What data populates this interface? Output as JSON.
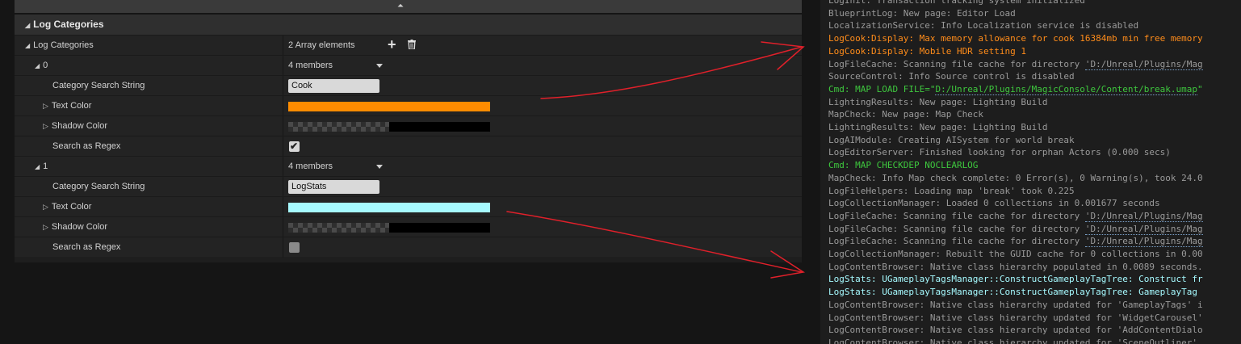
{
  "panel": {
    "header_title": "Log Categories",
    "array_label": "Log Categories",
    "array_value": "2 Array elements",
    "elements": [
      {
        "index": "0",
        "members": "4 members",
        "search_label": "Category Search String",
        "search_value": "Cook",
        "text_color_label": "Text Color",
        "text_color": "#ff8c00",
        "shadow_color_label": "Shadow Color",
        "regex_label": "Search as Regex",
        "regex_checked": true
      },
      {
        "index": "1",
        "members": "4 members",
        "search_label": "Category Search String",
        "search_value": "LogStats",
        "text_color_label": "Text Color",
        "text_color": "#a6faff",
        "shadow_color_label": "Shadow Color",
        "regex_label": "Search as Regex",
        "regex_checked": false
      }
    ]
  },
  "log": {
    "lines": [
      {
        "text": "LogInit: Transaction tracking system initialized",
        "color": "#9a9a9a"
      },
      {
        "text": "BlueprintLog: New page: Editor Load",
        "color": "#9a9a9a"
      },
      {
        "text": "LocalizationService: Info Localization service is disabled",
        "color": "#9a9a9a"
      },
      {
        "text": "LogCook:Display: Max memory allowance for cook 16384mb min free memory",
        "color": "#ff8c1a"
      },
      {
        "text": "LogCook:Display: Mobile HDR setting 1",
        "color": "#ff8c1a"
      },
      {
        "text": "LogFileCache: Scanning file cache for directory ",
        "path": "'D:/Unreal/Plugins/Mag",
        "color": "#9a9a9a"
      },
      {
        "text": "SourceControl: Info Source control is disabled",
        "color": "#9a9a9a"
      },
      {
        "text": "Cmd: MAP LOAD FILE=\"",
        "path": "D:/Unreal/Plugins/MagicConsole/Content/break.umap",
        "tail": "\"",
        "color": "#3ec83e"
      },
      {
        "text": "LightingResults: New page: Lighting Build",
        "color": "#9a9a9a"
      },
      {
        "text": "MapCheck: New page: Map Check",
        "color": "#9a9a9a"
      },
      {
        "text": "LightingResults: New page: Lighting Build",
        "color": "#9a9a9a"
      },
      {
        "text": "LogAIModule: Creating AISystem for world break",
        "color": "#9a9a9a"
      },
      {
        "text": "LogEditorServer: Finished looking for orphan Actors (0.000 secs)",
        "color": "#9a9a9a"
      },
      {
        "text": "Cmd: MAP CHECKDEP NOCLEARLOG",
        "color": "#3ec83e"
      },
      {
        "text": "MapCheck: Info Map check complete: 0 Error(s), 0 Warning(s), took 24.0",
        "color": "#9a9a9a"
      },
      {
        "text": "LogFileHelpers: Loading map 'break' took 0.225",
        "color": "#9a9a9a"
      },
      {
        "text": "LogCollectionManager: Loaded 0 collections in 0.001677 seconds",
        "color": "#9a9a9a"
      },
      {
        "text": "LogFileCache: Scanning file cache for directory ",
        "path": "'D:/Unreal/Plugins/Mag",
        "color": "#9a9a9a"
      },
      {
        "text": "LogFileCache: Scanning file cache for directory ",
        "path": "'D:/Unreal/Plugins/Mag",
        "color": "#9a9a9a"
      },
      {
        "text": "LogFileCache: Scanning file cache for directory ",
        "path": "'D:/Unreal/Plugins/Mag",
        "color": "#9a9a9a"
      },
      {
        "text": "LogCollectionManager: Rebuilt the GUID cache for 0 collections in 0.00",
        "color": "#9a9a9a"
      },
      {
        "text": "LogContentBrowser: Native class hierarchy populated in 0.0089 seconds.",
        "color": "#9a9a9a"
      },
      {
        "text": "LogStats: UGameplayTagsManager::ConstructGameplayTagTree: Construct fr",
        "color": "#a6faff"
      },
      {
        "text": "LogStats: UGameplayTagsManager::ConstructGameplayTagTree: GameplayTag",
        "color": "#a6faff"
      },
      {
        "text": "LogContentBrowser: Native class hierarchy updated for 'GameplayTags' i",
        "color": "#9a9a9a"
      },
      {
        "text": "LogContentBrowser: Native class hierarchy updated for 'WidgetCarousel'",
        "color": "#9a9a9a"
      },
      {
        "text": "LogContentBrowser: Native class hierarchy updated for 'AddContentDialo",
        "color": "#9a9a9a"
      },
      {
        "text": "LogContentBrowser: Native class hierarchy updated for 'SceneOutliner'",
        "color": "#9a9a9a"
      }
    ]
  },
  "icons": {
    "collapse": "chevron-up-icon",
    "add": "plus-icon",
    "delete": "trash-icon",
    "dropdown": "chevron-down-icon",
    "check": "checkmark-icon"
  },
  "annotation_color": "#e0202a"
}
